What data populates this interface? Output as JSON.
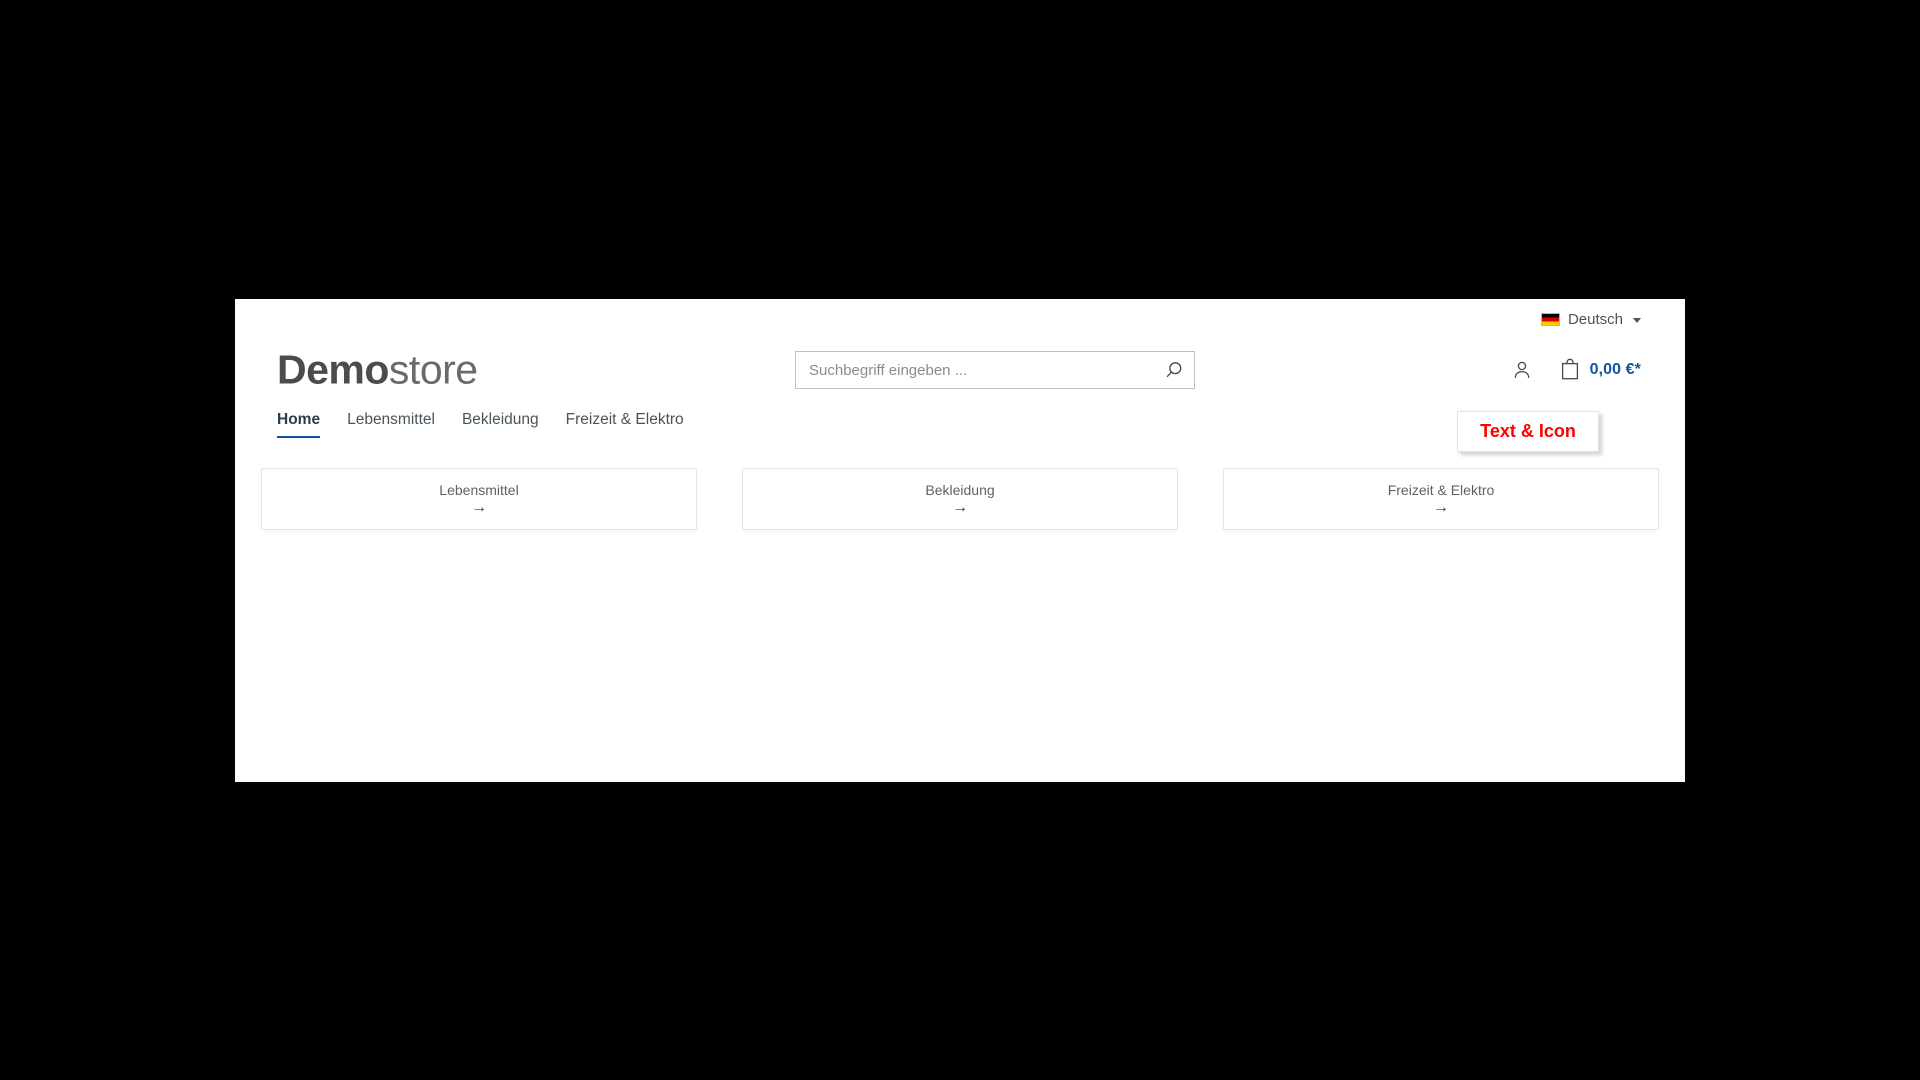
{
  "site": {
    "background_color": "#000000",
    "page_background": "#ffffff",
    "accent_blue": "#1455a0",
    "promo_red": "#ff0000"
  },
  "topbar": {
    "language": {
      "flag_icon": "flag-germany-icon",
      "label": "Deutsch",
      "caret_icon": "chevron-down-icon"
    }
  },
  "brand": {
    "strong": "Demo",
    "light": "store"
  },
  "search": {
    "placeholder": "Suchbegriff eingeben ...",
    "value": "",
    "submit_icon": "search-icon"
  },
  "header_actions": {
    "account_icon": "user-icon",
    "cart_icon": "shopping-bag-icon",
    "cart_amount": "0,00 €*"
  },
  "nav": {
    "items": [
      {
        "label": "Home",
        "active": true
      },
      {
        "label": "Lebensmittel",
        "active": false
      },
      {
        "label": "Bekleidung",
        "active": false
      },
      {
        "label": "Freizeit & Elektro",
        "active": false
      }
    ]
  },
  "promo": {
    "label": "Text & Icon"
  },
  "categories": {
    "arrow_glyph": "→",
    "items": [
      {
        "title": "Lebensmittel"
      },
      {
        "title": "Bekleidung"
      },
      {
        "title": "Freizeit & Elektro"
      }
    ]
  }
}
